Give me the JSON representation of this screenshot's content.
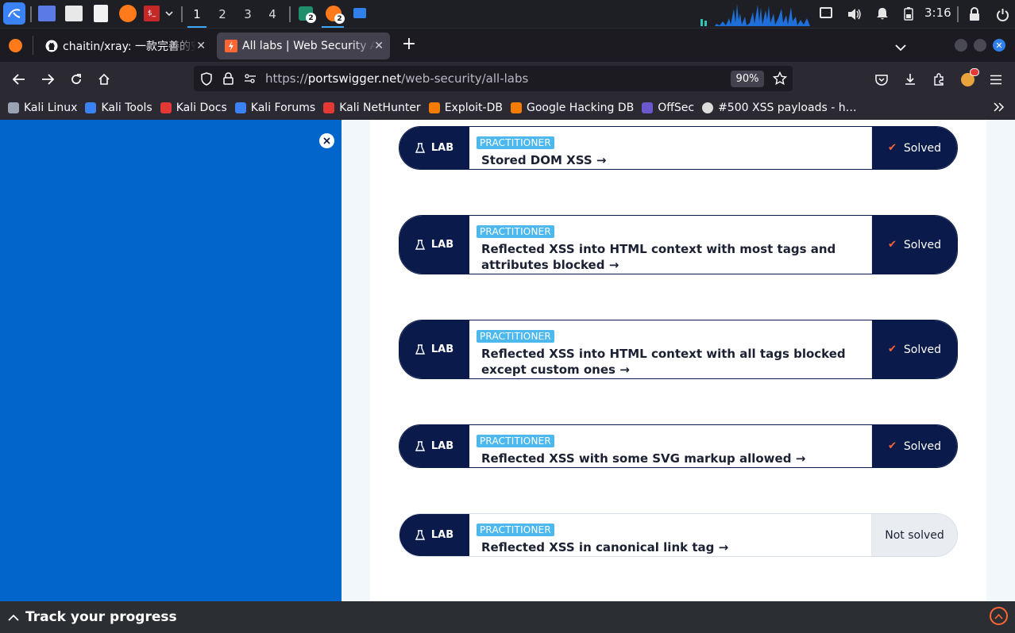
{
  "panel": {
    "workspaces": [
      "1",
      "2",
      "3",
      "4"
    ],
    "active_workspace": "1",
    "taskbar_badges": [
      "2",
      "2"
    ],
    "clock": "3:16"
  },
  "tabs": [
    {
      "title": "chaitin/xray: 一款完善的安全评估工具",
      "icon": "github-icon",
      "active": false
    },
    {
      "title": "All labs | Web Security Academy",
      "icon": "portswigger-icon",
      "active": true
    }
  ],
  "navbar": {
    "url_prefix": "https://",
    "url_host": "portswigger.net",
    "url_path": "/web-security/all-labs",
    "zoom": "90%"
  },
  "bookmarks": [
    {
      "label": "Kali Linux",
      "color": "#9aa3b4"
    },
    {
      "label": "Kali Tools",
      "color": "#3b82f6"
    },
    {
      "label": "Kali Docs",
      "color": "#e53935"
    },
    {
      "label": "Kali Forums",
      "color": "#3b82f6"
    },
    {
      "label": "Kali NetHunter",
      "color": "#e53935"
    },
    {
      "label": "Exploit-DB",
      "color": "#f57c00"
    },
    {
      "label": "Google Hacking DB",
      "color": "#f57c00"
    },
    {
      "label": "OffSec",
      "color": "#6a5acd"
    },
    {
      "label": "#500 XSS payloads - h…",
      "color": "#dddddd"
    }
  ],
  "labs": [
    {
      "tag": "LAB",
      "level": "PRACTITIONER",
      "title": "Stored DOM XSS",
      "status": "Solved"
    },
    {
      "tag": "LAB",
      "level": "PRACTITIONER",
      "title": "Reflected XSS into HTML context with most tags and attributes blocked",
      "status": "Solved"
    },
    {
      "tag": "LAB",
      "level": "PRACTITIONER",
      "title": "Reflected XSS into HTML context with all tags blocked except custom ones",
      "status": "Solved"
    },
    {
      "tag": "LAB",
      "level": "PRACTITIONER",
      "title": "Reflected XSS with some SVG markup allowed",
      "status": "Solved"
    },
    {
      "tag": "LAB",
      "level": "PRACTITIONER",
      "title": "Reflected XSS in canonical link tag",
      "status": "Not solved"
    }
  ],
  "track_bar": {
    "label": "Track your progress"
  },
  "colors": {
    "sidebar": "#0066cc",
    "lab_dark": "#0a1a4a",
    "level_badge": "#4cb8ee",
    "check": "#ff6633"
  }
}
